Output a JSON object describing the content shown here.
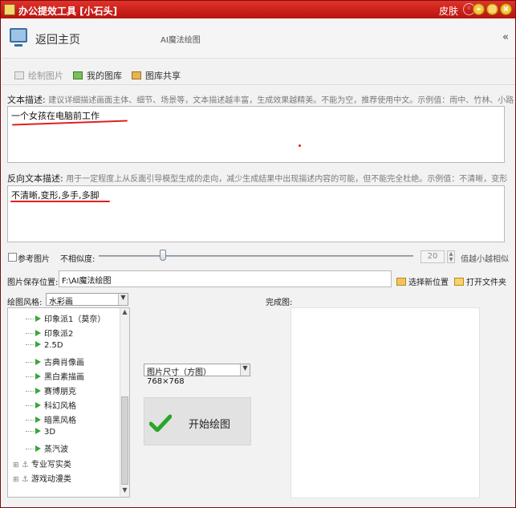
{
  "window": {
    "title": "办公提效工具 [小石头]",
    "skin_label": "皮肤"
  },
  "header": {
    "back_label": "返回主页",
    "breadcrumb": "AI魔法绘图",
    "collapse_glyph": "«"
  },
  "toolbar": {
    "items": [
      {
        "label": "绘制图片",
        "disabled": true
      },
      {
        "label": "我的图库"
      },
      {
        "label": "图库共享"
      }
    ]
  },
  "prompt": {
    "label": "文本描述:",
    "hint": "建议详细描述画面主体、细节、场景等，文本描述越丰富，生成效果越精美。不能为空，推荐使用中文。示例值：雨中、竹林、小路",
    "value": "一个女孩在电脑前工作"
  },
  "negative": {
    "label": "反向文本描述:",
    "hint": "用于一定程度上从反面引导模型生成的走向，减少生成结果中出现描述内容的可能，但不能完全杜绝。示例值：不清晰，变形",
    "value": "不清晰,变形,多手,多脚"
  },
  "reference": {
    "checkbox_label": "参考图片",
    "similarity_label": "不相似度:",
    "similarity_value": "20",
    "similarity_fraction": 0.2,
    "suffix": "值越小越相似"
  },
  "save": {
    "label": "图片保存位置:",
    "path": "F:\\AI魔法绘图",
    "choose_label": "选择新位置",
    "open_label": "打开文件夹"
  },
  "style": {
    "label": "绘图风格:",
    "selected": "水彩画",
    "tree_items": [
      "印象派1（莫奈）",
      "印象派2",
      "2.5D",
      "古典肖像画",
      "黑白素描画",
      "赛博朋克",
      "科幻风格",
      "暗黑风格",
      "3D",
      "蒸汽波"
    ],
    "tree_groups": [
      "专业写实类",
      "游戏动漫类"
    ]
  },
  "size": {
    "selected": "图片尺寸（方图）768×768"
  },
  "start_label": "开始绘图",
  "result_label": "完成图:"
}
